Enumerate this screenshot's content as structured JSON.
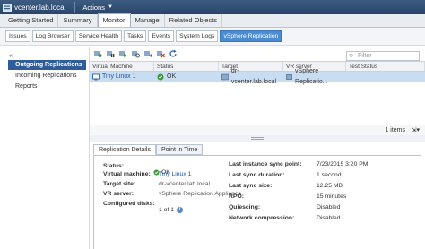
{
  "window": {
    "title": "vcenter.lab.local",
    "actions_label": "Actions"
  },
  "main_tabs": [
    "Getting Started",
    "Summary",
    "Monitor",
    "Manage",
    "Related Objects"
  ],
  "sub_tabs": [
    "Issues",
    "Log Browser",
    "Service Health",
    "Tasks",
    "Events",
    "System Logs",
    "vSphere Replication"
  ],
  "sidebar": {
    "items": [
      "Outgoing Replications",
      "Incoming Replications",
      "Reports"
    ]
  },
  "filter": {
    "placeholder": "Filter"
  },
  "grid": {
    "columns": [
      "Virtual Machine",
      "Status",
      "Target",
      "VR server",
      "Test Status"
    ],
    "row": {
      "vm": "Tiny Linux 1",
      "status": "OK",
      "target": "dr-vcenter.lab.local",
      "vr_server": "vSphere Replicatio...",
      "test_status": ""
    },
    "count": "1 items"
  },
  "detail_tabs": [
    "Replication Details",
    "Point in Time"
  ],
  "details": {
    "left": [
      {
        "label": "Status:",
        "value": "OK"
      },
      {
        "label": "Virtual machine:",
        "value": "Tiny Linux 1"
      },
      {
        "label": "Target site:",
        "value": "dr-vcenter.lab.local"
      },
      {
        "label": "VR server:",
        "value": "vSphere Replication Appliance"
      },
      {
        "label": "Configured disks:",
        "value": "1 of 1"
      }
    ],
    "right": [
      {
        "label": "Last instance sync point:",
        "value": "7/23/2015 3:20 PM"
      },
      {
        "label": "Last sync duration:",
        "value": "1 second"
      },
      {
        "label": "Last sync size:",
        "value": "12.25 MB"
      },
      {
        "label": "RPO:",
        "value": "15 minutes"
      },
      {
        "label": "Quiescing:",
        "value": "Disabled"
      },
      {
        "label": "Network compression:",
        "value": "Disabled"
      }
    ]
  },
  "colors": {
    "accent": "#4a8bd2",
    "nav_selected": "#2f5d99",
    "row_selected": "#c8dcf2",
    "ok": "#3a9a3a"
  }
}
